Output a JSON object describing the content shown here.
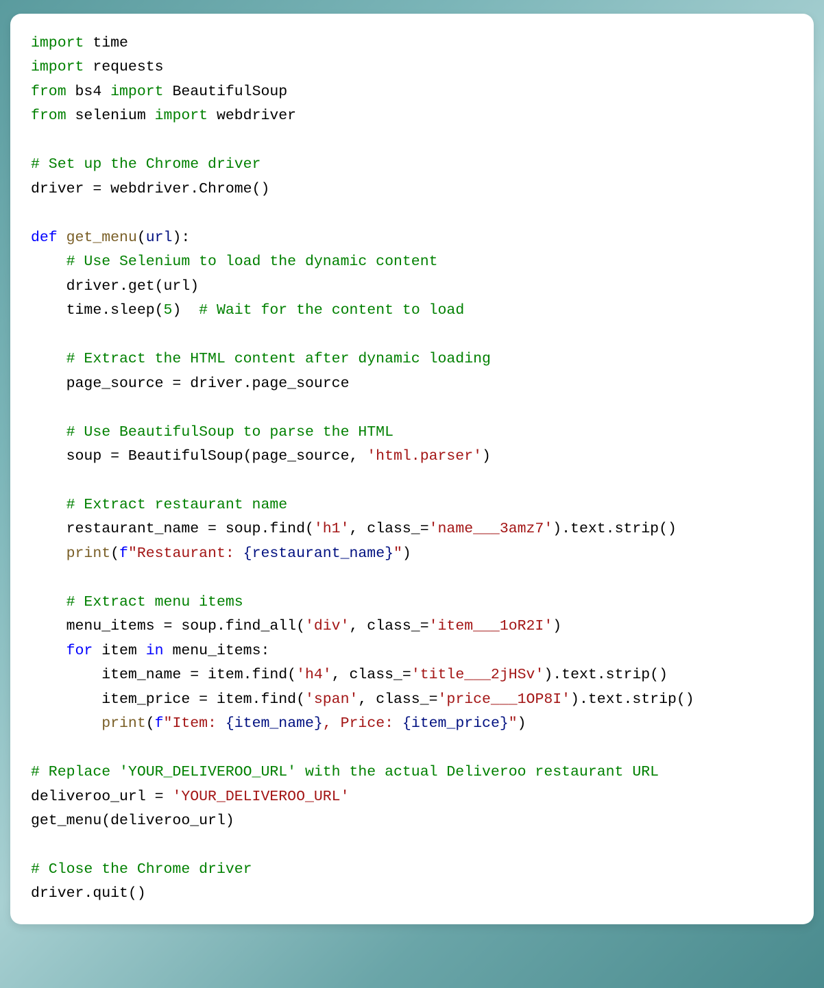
{
  "code": {
    "lines": [
      {
        "type": "import",
        "tokens": [
          {
            "t": "import",
            "c": "kw"
          },
          {
            "t": " time",
            "c": "var"
          }
        ]
      },
      {
        "type": "import",
        "tokens": [
          {
            "t": "import",
            "c": "kw"
          },
          {
            "t": " requests",
            "c": "var"
          }
        ]
      },
      {
        "type": "import",
        "tokens": [
          {
            "t": "from",
            "c": "kw"
          },
          {
            "t": " bs4 ",
            "c": "var"
          },
          {
            "t": "import",
            "c": "kw"
          },
          {
            "t": " BeautifulSoup",
            "c": "var"
          }
        ]
      },
      {
        "type": "import",
        "tokens": [
          {
            "t": "from",
            "c": "kw"
          },
          {
            "t": " selenium ",
            "c": "var"
          },
          {
            "t": "import",
            "c": "kw"
          },
          {
            "t": " webdriver",
            "c": "var"
          }
        ]
      },
      {
        "type": "blank",
        "tokens": []
      },
      {
        "type": "comment",
        "tokens": [
          {
            "t": "# Set up the Chrome driver",
            "c": "comment"
          }
        ]
      },
      {
        "type": "code",
        "tokens": [
          {
            "t": "driver = webdriver.Chrome()",
            "c": "var"
          }
        ]
      },
      {
        "type": "blank",
        "tokens": []
      },
      {
        "type": "def",
        "tokens": [
          {
            "t": "def",
            "c": "kw-blue"
          },
          {
            "t": " ",
            "c": "var"
          },
          {
            "t": "get_menu",
            "c": "func"
          },
          {
            "t": "(",
            "c": "var"
          },
          {
            "t": "url",
            "c": "param"
          },
          {
            "t": "):",
            "c": "var"
          }
        ]
      },
      {
        "type": "comment",
        "tokens": [
          {
            "t": "    ",
            "c": "var"
          },
          {
            "t": "# Use Selenium to load the dynamic content",
            "c": "comment"
          }
        ]
      },
      {
        "type": "code",
        "tokens": [
          {
            "t": "    driver.get(url)",
            "c": "var"
          }
        ]
      },
      {
        "type": "code",
        "tokens": [
          {
            "t": "    time.sleep(",
            "c": "var"
          },
          {
            "t": "5",
            "c": "comment"
          },
          {
            "t": ")  ",
            "c": "var"
          },
          {
            "t": "# Wait for the content to load",
            "c": "comment"
          }
        ]
      },
      {
        "type": "blank",
        "tokens": []
      },
      {
        "type": "comment",
        "tokens": [
          {
            "t": "    ",
            "c": "var"
          },
          {
            "t": "# Extract the HTML content after dynamic loading",
            "c": "comment"
          }
        ]
      },
      {
        "type": "code",
        "tokens": [
          {
            "t": "    page_source = driver.page_source",
            "c": "var"
          }
        ]
      },
      {
        "type": "blank",
        "tokens": []
      },
      {
        "type": "comment",
        "tokens": [
          {
            "t": "    ",
            "c": "var"
          },
          {
            "t": "# Use BeautifulSoup to parse the HTML",
            "c": "comment"
          }
        ]
      },
      {
        "type": "code",
        "tokens": [
          {
            "t": "    soup = BeautifulSoup(page_source, ",
            "c": "var"
          },
          {
            "t": "'html.parser'",
            "c": "string"
          },
          {
            "t": ")",
            "c": "var"
          }
        ]
      },
      {
        "type": "blank",
        "tokens": []
      },
      {
        "type": "comment",
        "tokens": [
          {
            "t": "    ",
            "c": "var"
          },
          {
            "t": "# Extract restaurant name",
            "c": "comment"
          }
        ]
      },
      {
        "type": "code",
        "tokens": [
          {
            "t": "    restaurant_name = soup.find(",
            "c": "var"
          },
          {
            "t": "'h1'",
            "c": "string"
          },
          {
            "t": ", class_=",
            "c": "var"
          },
          {
            "t": "'name___3amz7'",
            "c": "string"
          },
          {
            "t": ").text.strip()",
            "c": "var"
          }
        ]
      },
      {
        "type": "code",
        "tokens": [
          {
            "t": "    ",
            "c": "var"
          },
          {
            "t": "print",
            "c": "builtin"
          },
          {
            "t": "(",
            "c": "var"
          },
          {
            "t": "f",
            "c": "fstring-prefix"
          },
          {
            "t": "\"Restaurant: ",
            "c": "string"
          },
          {
            "t": "{restaurant_name}",
            "c": "param"
          },
          {
            "t": "\"",
            "c": "string"
          },
          {
            "t": ")",
            "c": "var"
          }
        ]
      },
      {
        "type": "blank",
        "tokens": []
      },
      {
        "type": "comment",
        "tokens": [
          {
            "t": "    ",
            "c": "var"
          },
          {
            "t": "# Extract menu items",
            "c": "comment"
          }
        ]
      },
      {
        "type": "code",
        "tokens": [
          {
            "t": "    menu_items = soup.find_all(",
            "c": "var"
          },
          {
            "t": "'div'",
            "c": "string"
          },
          {
            "t": ", class_=",
            "c": "var"
          },
          {
            "t": "'item___1oR2I'",
            "c": "string"
          },
          {
            "t": ")",
            "c": "var"
          }
        ]
      },
      {
        "type": "code",
        "tokens": [
          {
            "t": "    ",
            "c": "var"
          },
          {
            "t": "for",
            "c": "kw-blue"
          },
          {
            "t": " item ",
            "c": "var"
          },
          {
            "t": "in",
            "c": "kw-blue"
          },
          {
            "t": " menu_items:",
            "c": "var"
          }
        ]
      },
      {
        "type": "code",
        "tokens": [
          {
            "t": "        item_name = item.find(",
            "c": "var"
          },
          {
            "t": "'h4'",
            "c": "string"
          },
          {
            "t": ", class_=",
            "c": "var"
          },
          {
            "t": "'title___2jHSv'",
            "c": "string"
          },
          {
            "t": ").text.strip()",
            "c": "var"
          }
        ]
      },
      {
        "type": "code",
        "tokens": [
          {
            "t": "        item_price = item.find(",
            "c": "var"
          },
          {
            "t": "'span'",
            "c": "string"
          },
          {
            "t": ", class_=",
            "c": "var"
          },
          {
            "t": "'price___1OP8I'",
            "c": "string"
          },
          {
            "t": ").text.strip()",
            "c": "var"
          }
        ]
      },
      {
        "type": "code",
        "tokens": [
          {
            "t": "        ",
            "c": "var"
          },
          {
            "t": "print",
            "c": "builtin"
          },
          {
            "t": "(",
            "c": "var"
          },
          {
            "t": "f",
            "c": "fstring-prefix"
          },
          {
            "t": "\"Item: ",
            "c": "string"
          },
          {
            "t": "{item_name}",
            "c": "param"
          },
          {
            "t": ", Price: ",
            "c": "string"
          },
          {
            "t": "{item_price}",
            "c": "param"
          },
          {
            "t": "\"",
            "c": "string"
          },
          {
            "t": ")",
            "c": "var"
          }
        ]
      },
      {
        "type": "blank",
        "tokens": []
      },
      {
        "type": "comment",
        "tokens": [
          {
            "t": "# Replace 'YOUR_DELIVEROO_URL' with the actual Deliveroo restaurant URL",
            "c": "comment"
          }
        ]
      },
      {
        "type": "code",
        "tokens": [
          {
            "t": "deliveroo_url = ",
            "c": "var"
          },
          {
            "t": "'YOUR_DELIVEROO_URL'",
            "c": "string"
          }
        ]
      },
      {
        "type": "code",
        "tokens": [
          {
            "t": "get_menu(deliveroo_url)",
            "c": "var"
          }
        ]
      },
      {
        "type": "blank",
        "tokens": []
      },
      {
        "type": "comment",
        "tokens": [
          {
            "t": "# Close the Chrome driver",
            "c": "comment"
          }
        ]
      },
      {
        "type": "code",
        "tokens": [
          {
            "t": "driver.quit()",
            "c": "var"
          }
        ]
      }
    ]
  }
}
